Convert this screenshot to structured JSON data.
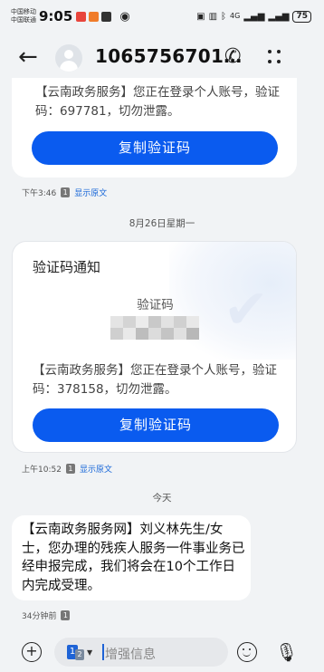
{
  "status_bar": {
    "carrier_1": "中国移动",
    "carrier_2": "中国联通",
    "time": "9:05",
    "network": "4G",
    "battery": "75"
  },
  "header": {
    "contact": "1065756701…"
  },
  "messages": [
    {
      "text": "【云南政务服务】您正在登录个人账号，验证码：697781，切勿泄露。",
      "button": "复制验证码",
      "time": "下午3:46",
      "sim": "1",
      "show_original": "显示原文"
    },
    {
      "date_separator": "8月26日星期一",
      "title": "验证码通知",
      "code_label": "验证码",
      "text": "【云南政务服务】您正在登录个人账号，验证码：378158，切勿泄露。",
      "button": "复制验证码",
      "time": "上午10:52",
      "sim": "1",
      "show_original": "显示原文"
    },
    {
      "date_separator": "今天",
      "text": "【云南政务服务网】刘义林先生/女士，您办理的残疾人服务一件事业务已经申报完成，我们将会在10个工作日内完成受理。",
      "time": "34分钟前",
      "sim": "1"
    }
  ],
  "composer": {
    "sim_primary": "1",
    "sim_secondary": "2",
    "placeholder": "增强信息"
  },
  "icons": [
    "back-arrow-icon",
    "avatar-icon",
    "phone-icon",
    "more-icon",
    "add-icon",
    "sim-select-icon",
    "emoji-icon",
    "microphone-icon"
  ],
  "colors": {
    "accent": "#0a5bef",
    "link": "#1565d8",
    "background": "#f1f3f5"
  }
}
